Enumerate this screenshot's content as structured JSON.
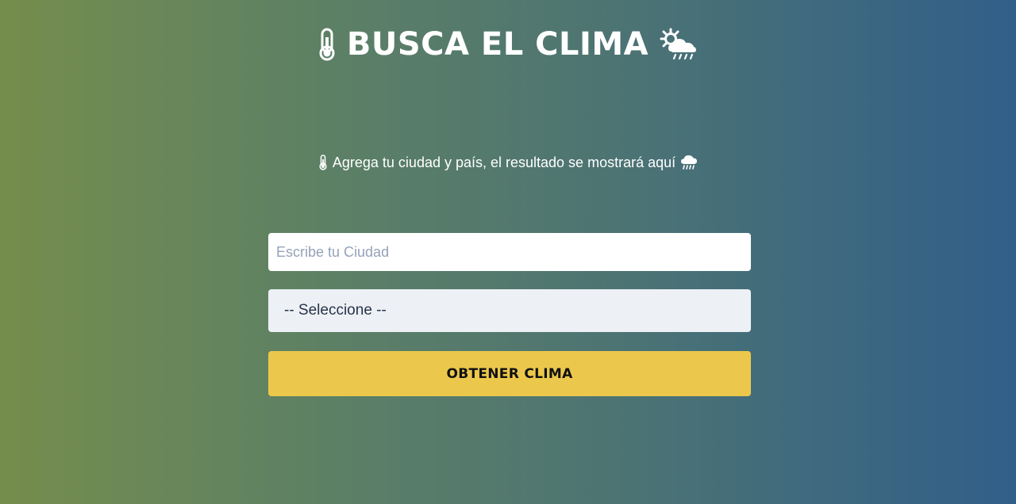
{
  "header": {
    "title": "BUSCA EL CLIMA",
    "left_icon": "thermometer-icon",
    "right_icon": "sun-behind-rain-cloud-icon"
  },
  "subtitle": {
    "text": "Agrega tu ciudad y país, el resultado se mostrará aquí",
    "left_icon": "thermometer-icon",
    "right_icon": "rain-cloud-icon"
  },
  "form": {
    "city_input": {
      "placeholder": "Escribe tu Ciudad",
      "value": ""
    },
    "country_select": {
      "selected": "-- Seleccione --"
    },
    "submit_label": "OBTENER CLIMA"
  },
  "colors": {
    "gradient_left": "#758d4c",
    "gradient_right": "#315f89",
    "button_bg": "#ebc84b",
    "select_bg": "#edf0f5"
  }
}
